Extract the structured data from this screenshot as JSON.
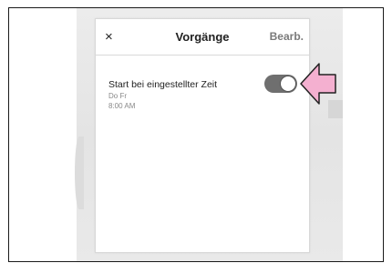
{
  "header": {
    "close_symbol": "×",
    "title": "Vorgänge",
    "edit_label": "Bearb."
  },
  "item": {
    "title": "Start bei eingestellter Zeit",
    "days": "Do Fr",
    "time": "8:00 AM",
    "toggle_on": true
  },
  "colors": {
    "pointer_arrow": "#f4b0d0",
    "toggle_track": "#6f6f6f"
  }
}
